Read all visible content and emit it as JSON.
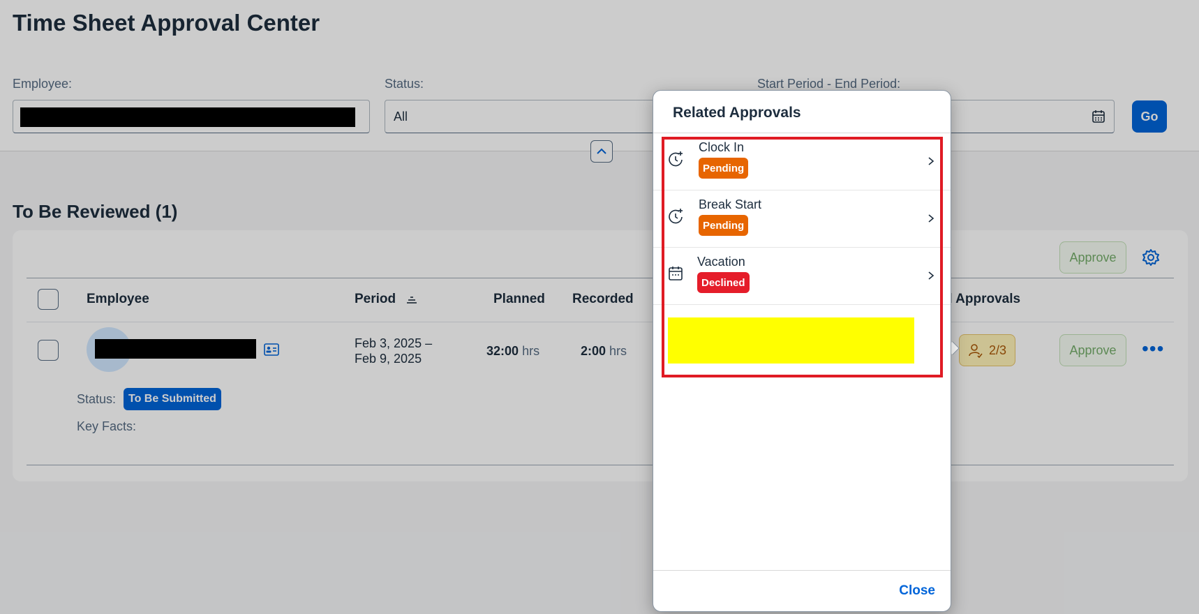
{
  "page": {
    "title": "Time Sheet Approval Center"
  },
  "filters": {
    "employee_label": "Employee:",
    "status_label": "Status:",
    "status_value": "All",
    "period_label": "Start Period - End Period:",
    "go_label": "Go"
  },
  "review": {
    "section_title": "To Be Reviewed (1)",
    "toolbar_approve": "Approve",
    "columns": {
      "employee": "Employee",
      "period": "Period",
      "planned": "Planned",
      "recorded": "Recorded",
      "related_approvals": "d Approvals"
    },
    "row": {
      "period_line1": "Feb 3, 2025 –",
      "period_line2": "Feb 9, 2025",
      "planned_value": "32:00",
      "planned_unit": "hrs",
      "recorded_value": "2:00",
      "recorded_unit": "hrs",
      "approvals_count": "2/3",
      "approve_label": "Approve",
      "status_label": "Status:",
      "status_value": "To Be Submitted",
      "key_facts_label": "Key Facts:"
    }
  },
  "popover": {
    "title": "Related Approvals",
    "items": [
      {
        "label": "Clock In",
        "status": "Pending",
        "icon": "clock-in-icon"
      },
      {
        "label": "Break Start",
        "status": "Pending",
        "icon": "break-start-icon"
      },
      {
        "label": "Vacation",
        "status": "Declined",
        "icon": "calendar-icon"
      }
    ],
    "close_label": "Close"
  },
  "colors": {
    "pending": "#e76500",
    "declined": "#e51d2a",
    "accent": "#0064d9",
    "highlight": "#e01b24",
    "redaction_yellow": "#ffff00"
  }
}
